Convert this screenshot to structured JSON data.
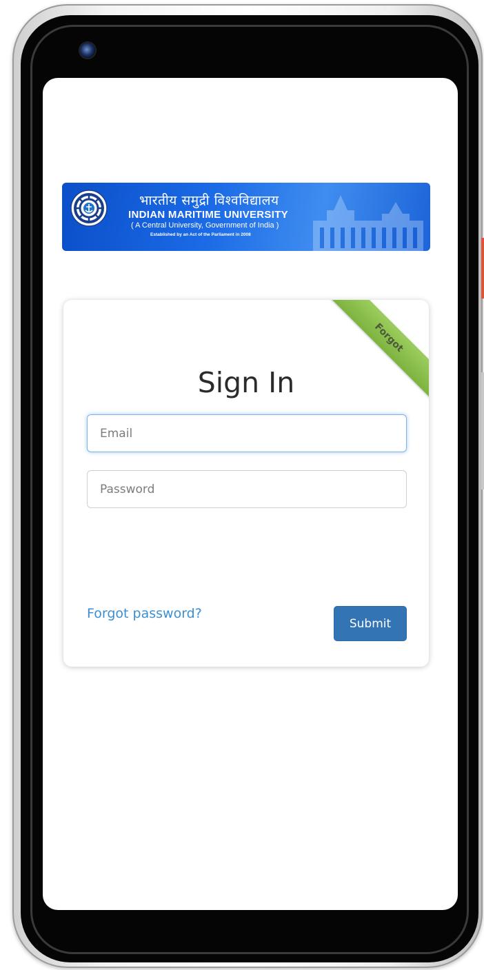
{
  "banner": {
    "hindi_title": "भारतीय समुद्री विश्वविद्यालय",
    "english_title": "INDIAN MARITIME UNIVERSITY",
    "subtitle": "( A Central University, Government of India )",
    "established": "Established by an Act of the Parliament in 2008"
  },
  "login": {
    "title": "Sign In",
    "ribbon_label": "Forgot",
    "email": {
      "placeholder": "Email",
      "value": ""
    },
    "password": {
      "placeholder": "Password",
      "value": ""
    },
    "forgot_link": "Forgot password?",
    "submit_label": "Submit"
  },
  "colors": {
    "banner_blue": "#1b6ae6",
    "ribbon_green": "#8cc14c",
    "link_blue": "#3b8ed3",
    "button_blue": "#3374b5"
  },
  "icons": {
    "camera": "camera-icon",
    "emblem": "university-emblem-icon"
  }
}
